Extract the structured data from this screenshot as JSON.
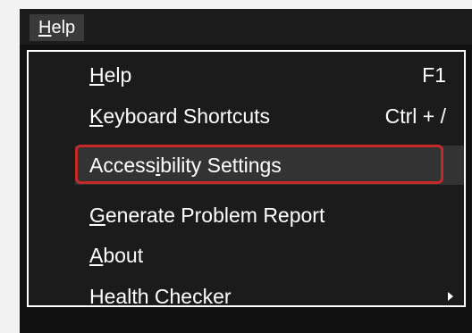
{
  "menubar": {
    "help_prefix": "",
    "help_mnemonic": "H",
    "help_rest": "elp"
  },
  "menu": {
    "items": [
      {
        "label_pre": "",
        "label_mn": "H",
        "label_post": "elp",
        "shortcut": "F1"
      },
      {
        "label_pre": "",
        "label_mn": "K",
        "label_post": "eyboard Shortcuts",
        "shortcut": "Ctrl + /"
      },
      {
        "label_pre": "Access",
        "label_mn": "i",
        "label_post": "bility Settings",
        "shortcut": ""
      },
      {
        "label_pre": "",
        "label_mn": "G",
        "label_post": "enerate Problem Report",
        "shortcut": ""
      },
      {
        "label_pre": "",
        "label_mn": "A",
        "label_post": "bout",
        "shortcut": ""
      },
      {
        "label_pre": "Hea",
        "label_mn": "l",
        "label_post": "th Checker",
        "shortcut": ""
      }
    ]
  },
  "colors": {
    "highlight_border": "#c62828",
    "menu_background": "#1b1b1b",
    "menu_border": "#ffffff"
  }
}
